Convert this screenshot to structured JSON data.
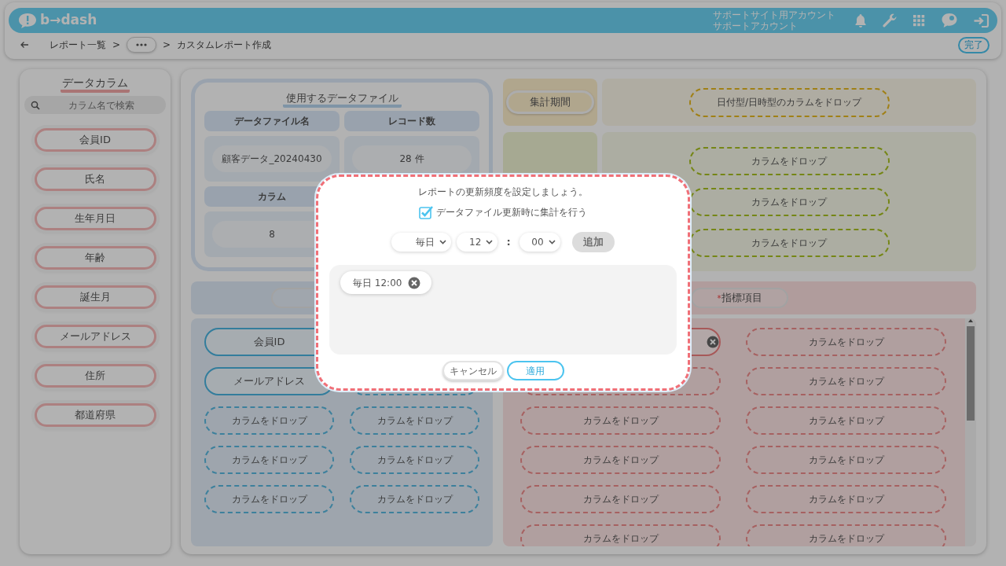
{
  "header": {
    "logo": "b→dash",
    "account_lines": [
      "サポートサイト用アカウント",
      "サポートアカウント"
    ]
  },
  "breadcrumb": [
    {
      "kind": "link",
      "label": "レポート一覧"
    },
    {
      "kind": "sep",
      "label": ">"
    },
    {
      "kind": "more"
    },
    {
      "kind": "sep",
      "label": ">"
    },
    {
      "kind": "current",
      "label": "カスタムレポート作成"
    }
  ],
  "done_button": "完了",
  "sidebar": {
    "title": "データカラム",
    "search_placeholder": "カラム名で検索",
    "items": [
      "会員ID",
      "氏名",
      "生年月日",
      "年齢",
      "誕生月",
      "メールアドレス",
      "住所",
      "都道府県"
    ]
  },
  "data_file": {
    "title": "使用するデータファイル",
    "cells": [
      {
        "header": "データファイル名",
        "value": "顧客データ_20240430"
      },
      {
        "header": "レコード数",
        "value": "28 件"
      },
      {
        "header": "カラム",
        "value": "8"
      }
    ]
  },
  "period": {
    "label": "集計期間",
    "drop": "日付型/日時型のカラムをドロップ"
  },
  "filters": {
    "drops": [
      "カラムをドロップ",
      "カラムをドロップ",
      "カラムをドロップ"
    ]
  },
  "dimensions": {
    "items": [
      {
        "kind": "filled",
        "label": "会員ID"
      },
      {
        "kind": "blank"
      },
      {
        "kind": "filled",
        "label": "メールアドレス"
      },
      {
        "kind": "drop"
      },
      {
        "kind": "drop",
        "label": "カラムをドロップ"
      },
      {
        "kind": "drop",
        "label": "カラムをドロップ"
      },
      {
        "kind": "drop",
        "label": "カラムをドロップ"
      },
      {
        "kind": "drop",
        "label": "カラムをドロップ"
      },
      {
        "kind": "drop",
        "label": "カラムをドロップ"
      },
      {
        "kind": "drop",
        "label": "カラムをドロップ"
      }
    ]
  },
  "measures": {
    "label": "指標項目",
    "required_mark": "*",
    "items": [
      {
        "kind": "filled"
      },
      {
        "kind": "drop",
        "label": "カラムをドロップ"
      },
      {
        "kind": "drop"
      },
      {
        "kind": "drop",
        "label": "カラムをドロップ"
      },
      {
        "kind": "drop",
        "label": "カラムをドロップ"
      },
      {
        "kind": "drop",
        "label": "カラムをドロップ"
      },
      {
        "kind": "drop",
        "label": "カラムをドロップ"
      },
      {
        "kind": "drop",
        "label": "カラムをドロップ"
      },
      {
        "kind": "drop",
        "label": "カラムをドロップ"
      },
      {
        "kind": "drop",
        "label": "カラムをドロップ"
      },
      {
        "kind": "drop",
        "label": "カラムをドロップ"
      },
      {
        "kind": "drop",
        "label": "カラムをドロップ"
      }
    ]
  },
  "modal": {
    "message": "レポートの更新頻度を設定しましょう。",
    "checkbox": {
      "label": "データファイル更新時に集計を行う",
      "checked": true
    },
    "selects": [
      {
        "value": "毎日"
      },
      {
        "value": "12"
      },
      {
        "value": "00"
      }
    ],
    "colon": ":",
    "add_button": {
      "label": "追加",
      "disabled": true
    },
    "schedules": [
      {
        "label": "毎日 12:00"
      }
    ],
    "cancel": "キャンセル",
    "apply": "適用"
  }
}
